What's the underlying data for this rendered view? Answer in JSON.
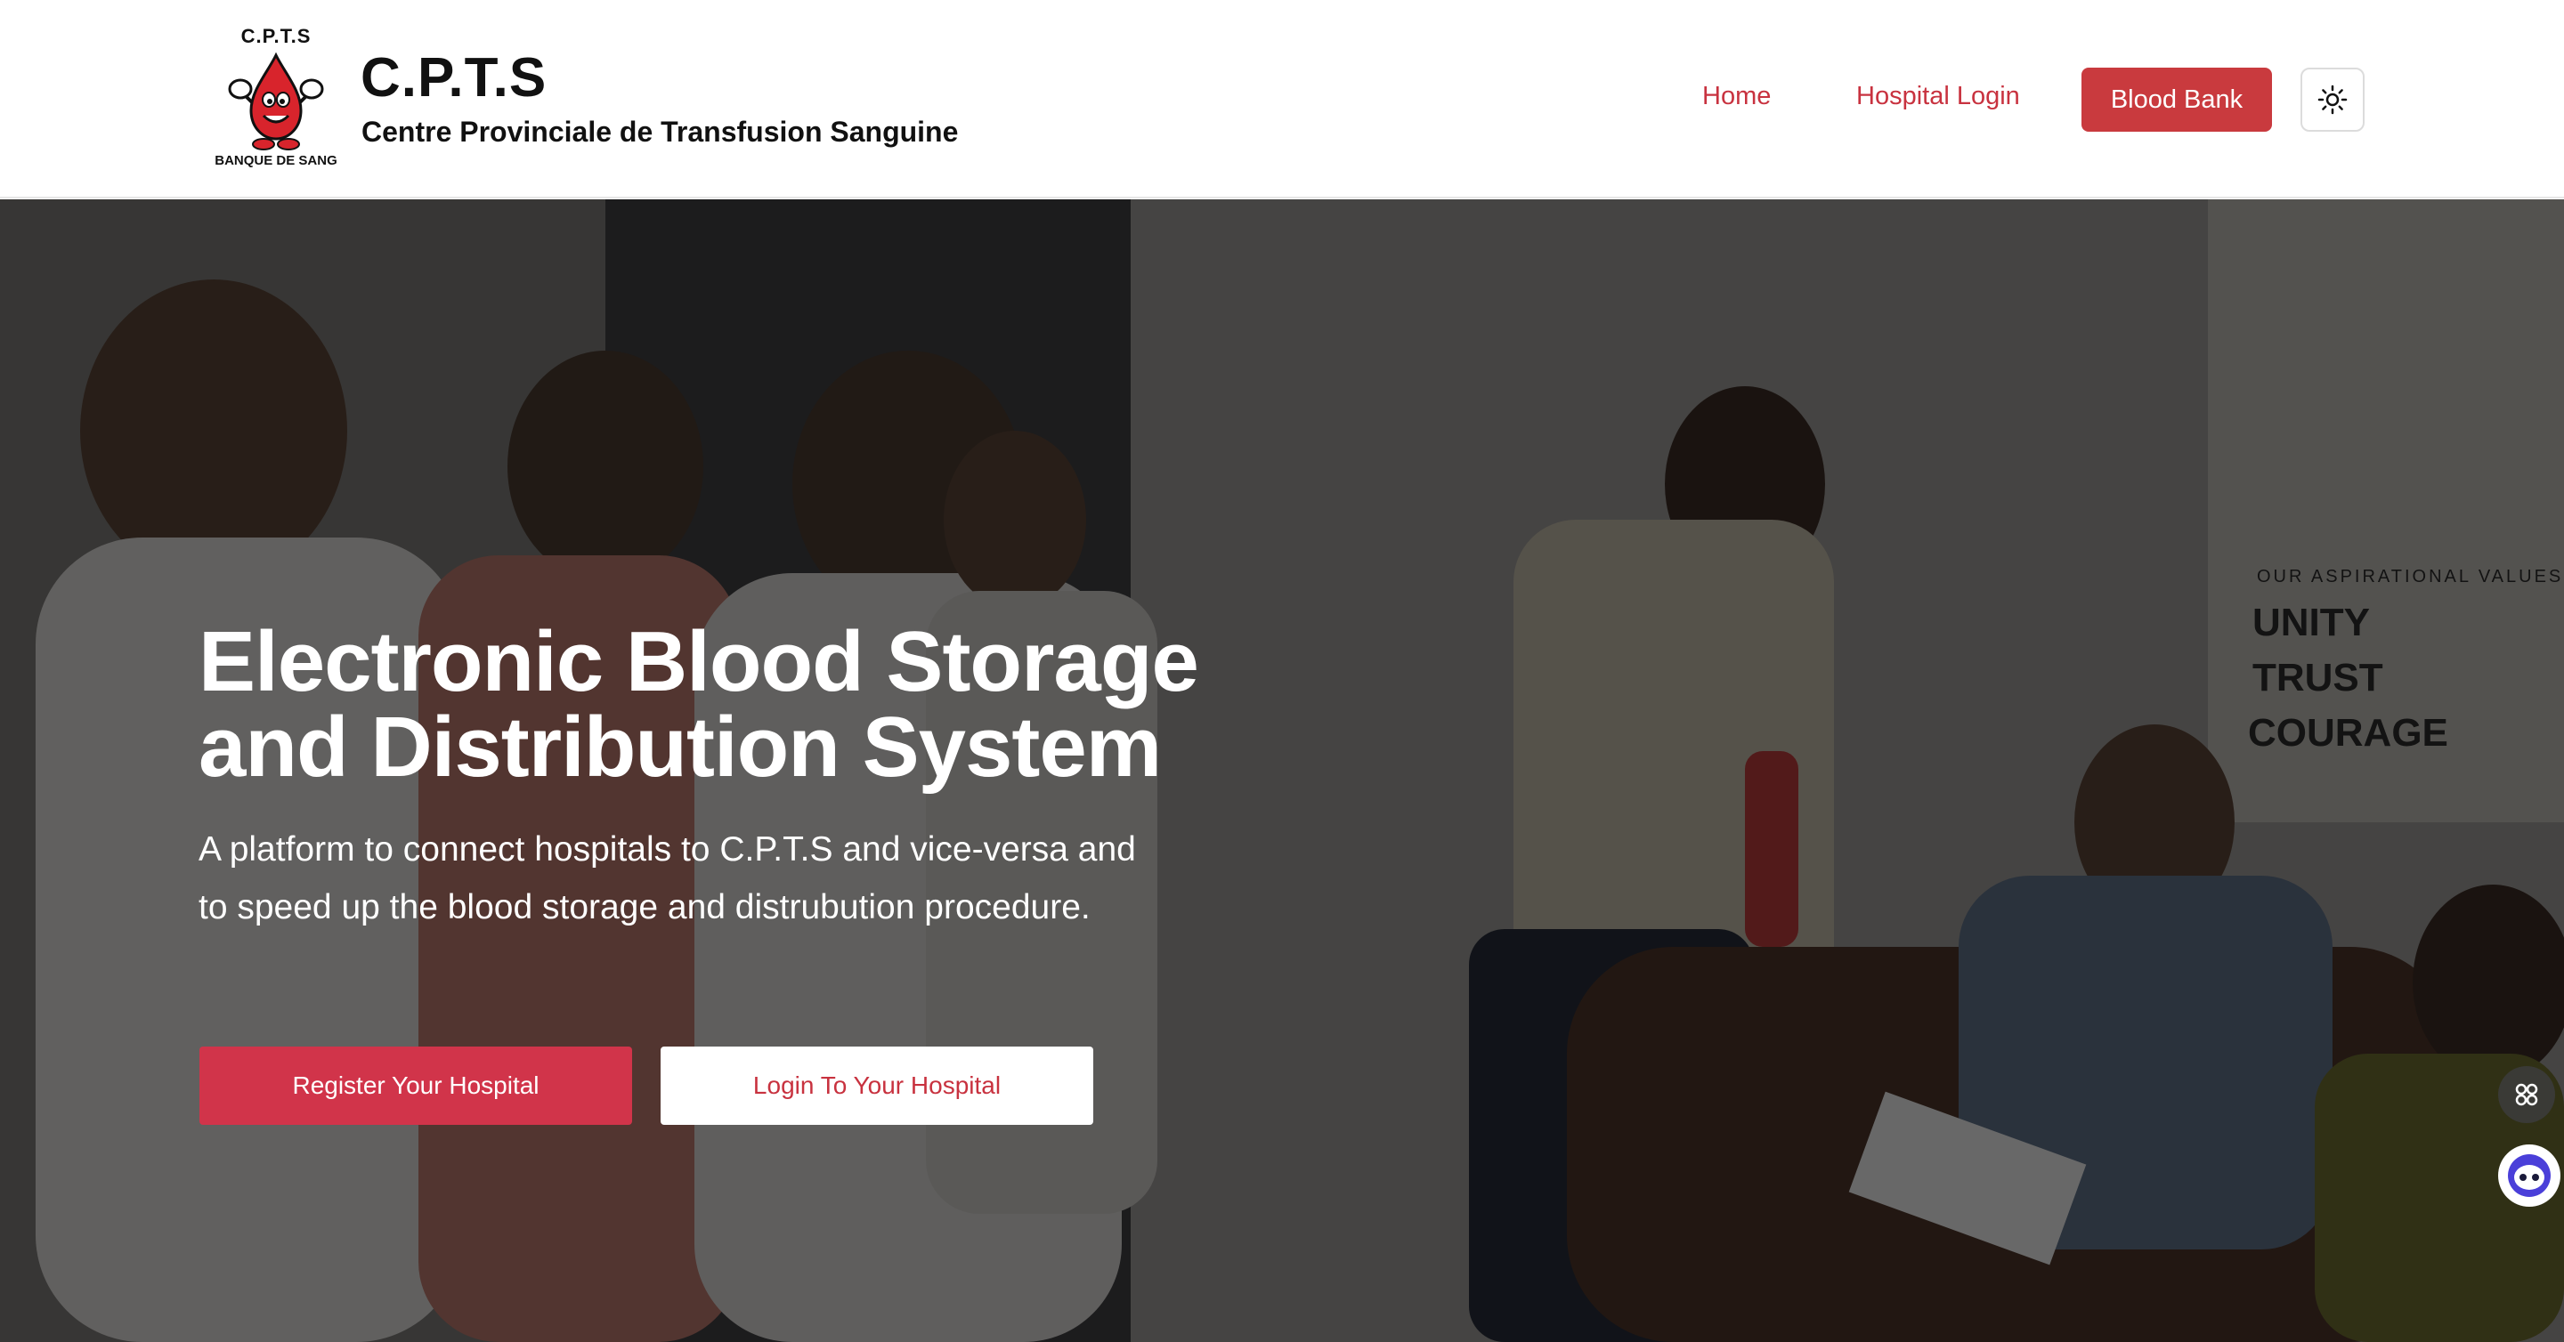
{
  "header": {
    "logo": {
      "top_text": "C.P.T.S",
      "bottom_text": "BANQUE DE SANG",
      "mascot": "blood-drop-mascot"
    },
    "brand_title": "C.P.T.S",
    "brand_subtitle": "Centre Provinciale de Transfusion Sanguine",
    "nav": {
      "home": "Home",
      "hospital_login": "Hospital Login",
      "blood_bank": "Blood Bank"
    },
    "theme_toggle_icon": "sun-icon"
  },
  "hero": {
    "title": "Electronic Blood Storage and Distribution System",
    "description": "A platform to connect hospitals to C.P.T.S and vice-versa and to speed up the blood storage and distrubution procedure.",
    "register_button": "Register Your Hospital",
    "login_button": "Login To Your Hospital",
    "background_text": [
      "OUR ASPIRATIONAL VALUES",
      "UNITY",
      "TRUST",
      "COURAGE"
    ]
  },
  "floating_widgets": [
    "command-icon",
    "assistant-bot-icon"
  ],
  "colors": {
    "primary_red": "#c93a3e",
    "button_red": "#d1344a",
    "link_red": "#c8323f"
  }
}
